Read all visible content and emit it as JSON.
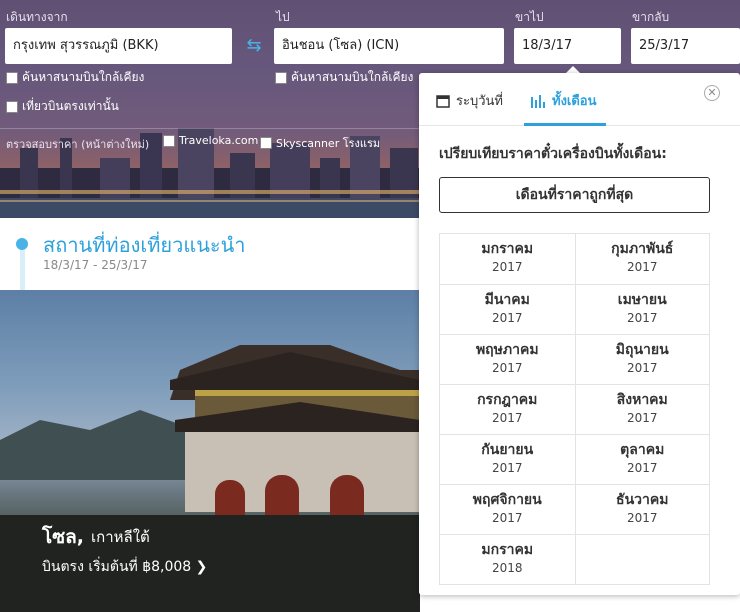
{
  "search": {
    "from_label": "เดินทางจาก",
    "from_value": "กรุงเทพ สุวรรณภูมิ (BKK)",
    "to_label": "ไป",
    "to_value": "อินชอน (โซล) (ICN)",
    "depart_label": "ขาไป",
    "depart_value": "18/3/17",
    "return_label": "ขากลับ",
    "return_value": "25/3/17",
    "nearby_from": "ค้นหาสนามบินใกล้เคียง",
    "nearby_to": "ค้นหาสนามบินใกล้เคียง",
    "direct_only": "เที่ยวบินตรงเท่านั้น",
    "price_check_label": "ตรวจสอบราคา (หน้าต่างใหม่)",
    "traveloka": "Traveloka.com",
    "skyscanner_hotels": "Skyscanner โรงแรม"
  },
  "recommended": {
    "title": "สถานที่ท่องเที่ยวแนะนำ",
    "dates": "18/3/17 - 25/3/17",
    "city": "โซล,",
    "country": "เกาหลีใต้",
    "price_line": "บินตรง เริ่มต้นที่ ฿8,008 ❯"
  },
  "popup": {
    "tab_date": "ระบุวันที่",
    "tab_month": "ทั้งเดือน",
    "compare_title": "เปรียบเทียบราคาตั๋วเครื่องบินทั้งเดือน:",
    "cheapest_button": "เดือนที่ราคาถูกที่สุด",
    "months": [
      {
        "name": "มกราคม",
        "year": "2017"
      },
      {
        "name": "กุมภาพันธ์",
        "year": "2017"
      },
      {
        "name": "มีนาคม",
        "year": "2017"
      },
      {
        "name": "เมษายน",
        "year": "2017"
      },
      {
        "name": "พฤษภาคม",
        "year": "2017"
      },
      {
        "name": "มิถุนายน",
        "year": "2017"
      },
      {
        "name": "กรกฎาคม",
        "year": "2017"
      },
      {
        "name": "สิงหาคม",
        "year": "2017"
      },
      {
        "name": "กันยายน",
        "year": "2017"
      },
      {
        "name": "ตุลาคม",
        "year": "2017"
      },
      {
        "name": "พฤศจิกายน",
        "year": "2017"
      },
      {
        "name": "ธันวาคม",
        "year": "2017"
      },
      {
        "name": "มกราคม",
        "year": "2018"
      }
    ]
  },
  "colors": {
    "accent": "#2da1dc",
    "hero_overlay": "#6f5f80"
  }
}
